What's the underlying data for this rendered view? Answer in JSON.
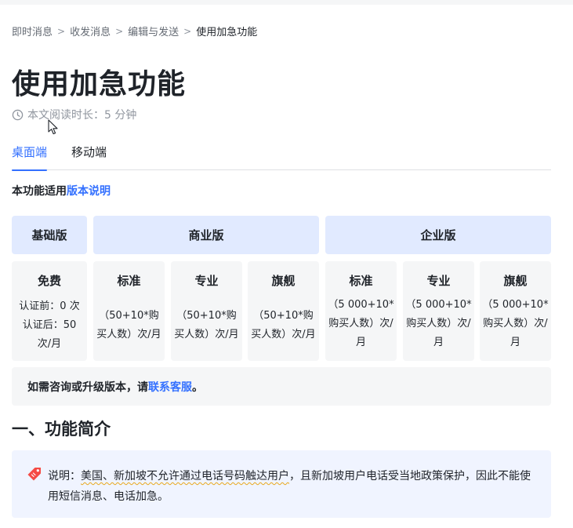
{
  "breadcrumb": {
    "items": [
      "即时消息",
      "收发消息",
      "编辑与发送",
      "使用加急功能"
    ],
    "separator": ">"
  },
  "title": "使用加急功能",
  "read_time": "本文阅读时长：5 分钟",
  "tabs": [
    {
      "label": "桌面端",
      "active": true
    },
    {
      "label": "移动端",
      "active": false
    }
  ],
  "applies": {
    "prefix": "本功能适用",
    "link": "版本说明"
  },
  "editions": [
    {
      "label": "基础版"
    },
    {
      "label": "商业版"
    },
    {
      "label": "企业版"
    }
  ],
  "plans": [
    {
      "name": "免费",
      "lines": [
        "认证前：0 次",
        "认证后：50 次/月"
      ]
    },
    {
      "name": "标准",
      "lines": [
        "（50+10*购买人数）次/月"
      ]
    },
    {
      "name": "专业",
      "lines": [
        "（50+10*购买人数）次/月"
      ]
    },
    {
      "name": "旗舰",
      "lines": [
        "（50+10*购买人数）次/月"
      ]
    },
    {
      "name": "标准",
      "lines": [
        "（5 000+10*购买人数）次/月"
      ]
    },
    {
      "name": "专业",
      "lines": [
        "（5 000+10*购买人数）次/月"
      ]
    },
    {
      "name": "旗舰",
      "lines": [
        "（5 000+10*购买人数）次/月"
      ]
    }
  ],
  "contact": {
    "prefix": "如需咨询或升级版本，请",
    "link": "联系客服",
    "suffix": "。"
  },
  "section_title": "一、功能简介",
  "note": {
    "prefix": "说明：",
    "underlined": "美国、新加坡不允许通过电话号码触达用户",
    "rest": "，且新加坡用户电话受当地政策保护，因此不能使用短信消息、电话加急。"
  },
  "colors": {
    "accent": "#3370ff",
    "edition_bg": "#e1eaff",
    "plan_bg": "#f5f6f7",
    "note_bg": "#f0f4ff",
    "note_icon": "#f54a45"
  },
  "icons": {
    "read_time": "clock-icon",
    "note": "tag-icon",
    "pointer": "mouse-cursor-icon"
  }
}
